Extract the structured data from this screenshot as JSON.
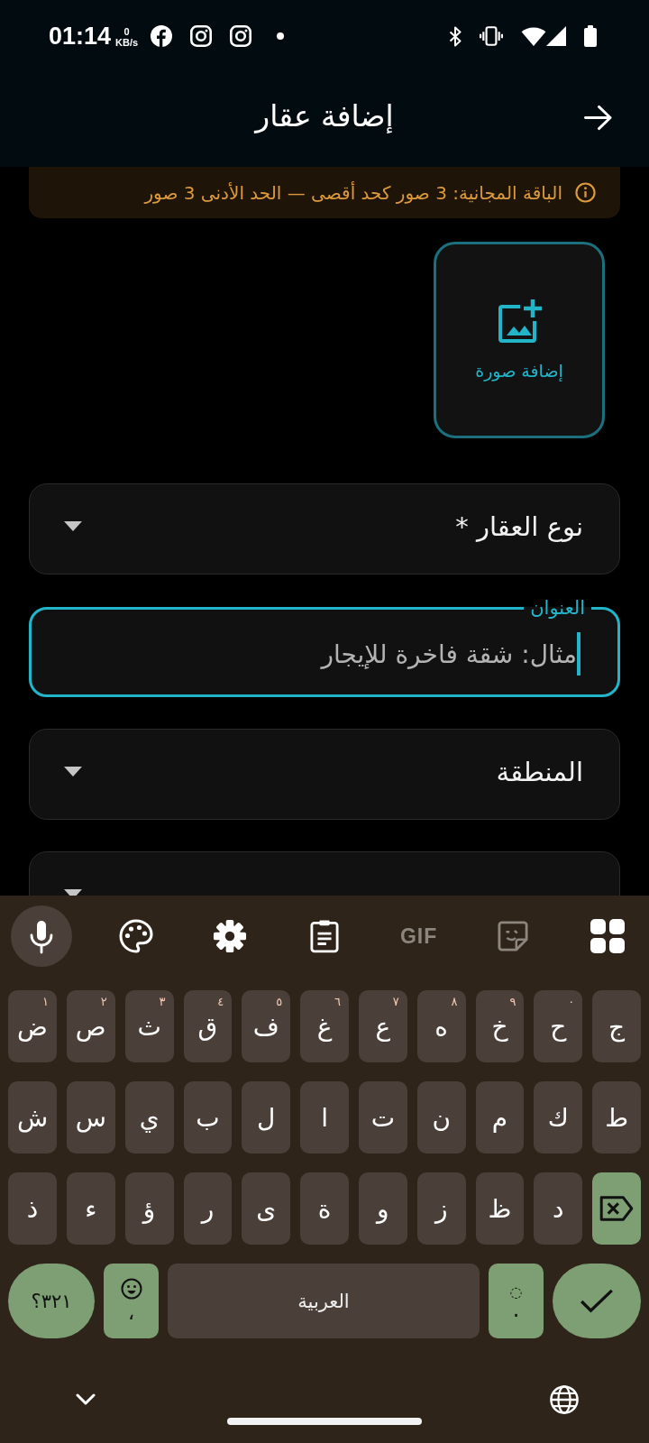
{
  "status_bar": {
    "time": "01:14",
    "net_speed": "0",
    "net_unit": "KB/s"
  },
  "app_bar": {
    "title": "إضافة عقار"
  },
  "notice": {
    "text": "الباقة المجانية: 3 صور كحد أقصى — الحد الأدنى 3 صور"
  },
  "photo_picker": {
    "label": "إضافة صورة"
  },
  "fields": [
    {
      "kind": "dropdown",
      "label": "نوع العقار *",
      "focused": false
    },
    {
      "kind": "text",
      "label": "العنوان",
      "placeholder": "مثال: شقة فاخرة للإيجار",
      "focused": true
    },
    {
      "kind": "dropdown",
      "label": "المنطقة",
      "focused": false
    },
    {
      "kind": "dropdown",
      "focused": false
    }
  ],
  "keyboard": {
    "toolbar": [
      {
        "kind": "mic",
        "disabled": false
      },
      {
        "kind": "palette",
        "disabled": false
      },
      {
        "kind": "settings",
        "disabled": false
      },
      {
        "kind": "clipboard",
        "disabled": false
      },
      {
        "kind": "gif",
        "label": "GIF",
        "disabled": true
      },
      {
        "kind": "sticker",
        "disabled": true
      },
      {
        "kind": "apps",
        "disabled": false
      }
    ],
    "letter_rows": [
      [
        {
          "kind": "letter",
          "label": "ج"
        },
        {
          "kind": "letter",
          "label": "ح",
          "hint": "٠"
        },
        {
          "kind": "letter",
          "label": "خ",
          "hint": "٩"
        },
        {
          "kind": "letter",
          "label": "ه",
          "hint": "٨"
        },
        {
          "kind": "letter",
          "label": "ع",
          "hint": "٧"
        },
        {
          "kind": "letter",
          "label": "غ",
          "hint": "٦"
        },
        {
          "kind": "letter",
          "label": "ف",
          "hint": "٥"
        },
        {
          "kind": "letter",
          "label": "ق",
          "hint": "٤"
        },
        {
          "kind": "letter",
          "label": "ث",
          "hint": "٣"
        },
        {
          "kind": "letter",
          "label": "ص",
          "hint": "٢"
        },
        {
          "kind": "letter",
          "label": "ض",
          "hint": "١"
        }
      ],
      [
        {
          "kind": "letter",
          "label": "ط"
        },
        {
          "kind": "letter",
          "label": "ك"
        },
        {
          "kind": "letter",
          "label": "م"
        },
        {
          "kind": "letter",
          "label": "ن"
        },
        {
          "kind": "letter",
          "label": "ت"
        },
        {
          "kind": "letter",
          "label": "ا"
        },
        {
          "kind": "letter",
          "label": "ل"
        },
        {
          "kind": "letter",
          "label": "ب"
        },
        {
          "kind": "letter",
          "label": "ي"
        },
        {
          "kind": "letter",
          "label": "س"
        },
        {
          "kind": "letter",
          "label": "ش"
        }
      ],
      [
        {
          "kind": "backspace"
        },
        {
          "kind": "letter",
          "label": "د"
        },
        {
          "kind": "letter",
          "label": "ظ"
        },
        {
          "kind": "letter",
          "label": "ز"
        },
        {
          "kind": "letter",
          "label": "و"
        },
        {
          "kind": "letter",
          "label": "ة"
        },
        {
          "kind": "letter",
          "label": "ى"
        },
        {
          "kind": "letter",
          "label": "ر"
        },
        {
          "kind": "letter",
          "label": "ؤ"
        },
        {
          "kind": "letter",
          "label": "ء"
        },
        {
          "kind": "letter",
          "label": "ذ"
        }
      ]
    ],
    "bottom_row": [
      {
        "kind": "enter"
      },
      {
        "kind": "period",
        "label": ".",
        "hint": "◌"
      },
      {
        "kind": "space",
        "label": "العربية"
      },
      {
        "kind": "emoji",
        "label": "،"
      },
      {
        "kind": "symbols",
        "label": "٣٢١؟"
      }
    ]
  }
}
